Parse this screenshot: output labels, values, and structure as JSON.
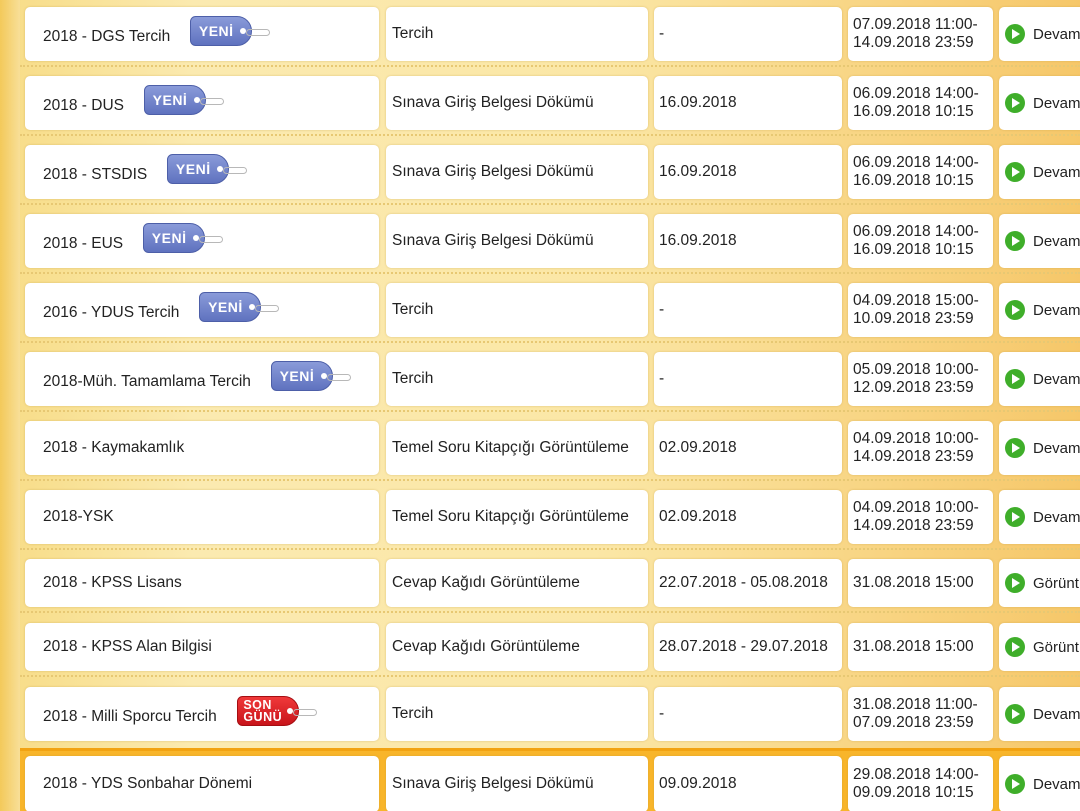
{
  "rows": [
    {
      "exam": "2018 - DGS Tercih",
      "badge": "YENİ",
      "badge_type": "new",
      "operation": "Tercih",
      "exam_date": "-",
      "period_start": "07.09.2018 11:00-",
      "period_end": "14.09.2018 23:59",
      "action": "Devam"
    },
    {
      "exam": "2018 - DUS",
      "badge": "YENİ",
      "badge_type": "new",
      "operation": "Sınava Giriş Belgesi Dökümü",
      "exam_date": "16.09.2018",
      "period_start": "06.09.2018 14:00-",
      "period_end": "16.09.2018 10:15",
      "action": "Devam"
    },
    {
      "exam": "2018 - STSDIS",
      "badge": "YENİ",
      "badge_type": "new",
      "operation": "Sınava Giriş Belgesi Dökümü",
      "exam_date": "16.09.2018",
      "period_start": "06.09.2018 14:00-",
      "period_end": "16.09.2018 10:15",
      "action": "Devam"
    },
    {
      "exam": "2018 - EUS",
      "badge": "YENİ",
      "badge_type": "new",
      "operation": "Sınava Giriş Belgesi Dökümü",
      "exam_date": "16.09.2018",
      "period_start": "06.09.2018 14:00-",
      "period_end": "16.09.2018 10:15",
      "action": "Devam"
    },
    {
      "exam": "2016 - YDUS Tercih",
      "badge": "YENİ",
      "badge_type": "new",
      "operation": "Tercih",
      "exam_date": "-",
      "period_start": "04.09.2018 15:00-",
      "period_end": "10.09.2018 23:59",
      "action": "Devam"
    },
    {
      "exam": "2018-Müh. Tamamlama Tercih",
      "badge": "YENİ",
      "badge_type": "new",
      "operation": "Tercih",
      "exam_date": "-",
      "period_start": "05.09.2018 10:00-",
      "period_end": "12.09.2018 23:59",
      "action": "Devam"
    },
    {
      "exam": "2018 - Kaymakamlık",
      "badge": "",
      "badge_type": "",
      "operation": "Temel Soru Kitapçığı Görüntüleme",
      "exam_date": "02.09.2018",
      "period_start": "04.09.2018 10:00-",
      "period_end": "14.09.2018 23:59",
      "action": "Devam"
    },
    {
      "exam": "2018-YSK",
      "badge": "",
      "badge_type": "",
      "operation": "Temel Soru Kitapçığı Görüntüleme",
      "exam_date": "02.09.2018",
      "period_start": "04.09.2018 10:00-",
      "period_end": "14.09.2018 23:59",
      "action": "Devam"
    },
    {
      "exam": "2018 - KPSS Lisans",
      "badge": "",
      "badge_type": "",
      "operation": "Cevap Kağıdı Görüntüleme",
      "exam_date": "22.07.2018 - 05.08.2018",
      "period_start": "31.08.2018 15:00",
      "period_end": "",
      "action": "Görünt"
    },
    {
      "exam": "2018 - KPSS Alan Bilgisi",
      "badge": "",
      "badge_type": "",
      "operation": "Cevap Kağıdı Görüntüleme",
      "exam_date": "28.07.2018 - 29.07.2018",
      "period_start": "31.08.2018 15:00",
      "period_end": "",
      "action": "Görünt"
    },
    {
      "exam": "2018 - Milli Sporcu Tercih",
      "badge_line1": "SON",
      "badge_line2": "GÜNÜ",
      "badge_type": "last",
      "operation": "Tercih",
      "exam_date": "-",
      "period_start": "31.08.2018 11:00-",
      "period_end": "07.09.2018 23:59",
      "action": "Devam"
    },
    {
      "exam": "2018 - YDS Sonbahar Dönemi",
      "badge": "",
      "badge_type": "",
      "operation": "Sınava Giriş Belgesi Dökümü",
      "exam_date": "09.09.2018",
      "period_start": "29.08.2018 14:00-",
      "period_end": "09.09.2018 10:15",
      "action": "Devam"
    }
  ],
  "colors": {
    "new_badge": "#6f82c9",
    "last_day_badge": "#e0242a",
    "play_icon": "#3fae2a",
    "highlight_row": "#f8b52a"
  }
}
